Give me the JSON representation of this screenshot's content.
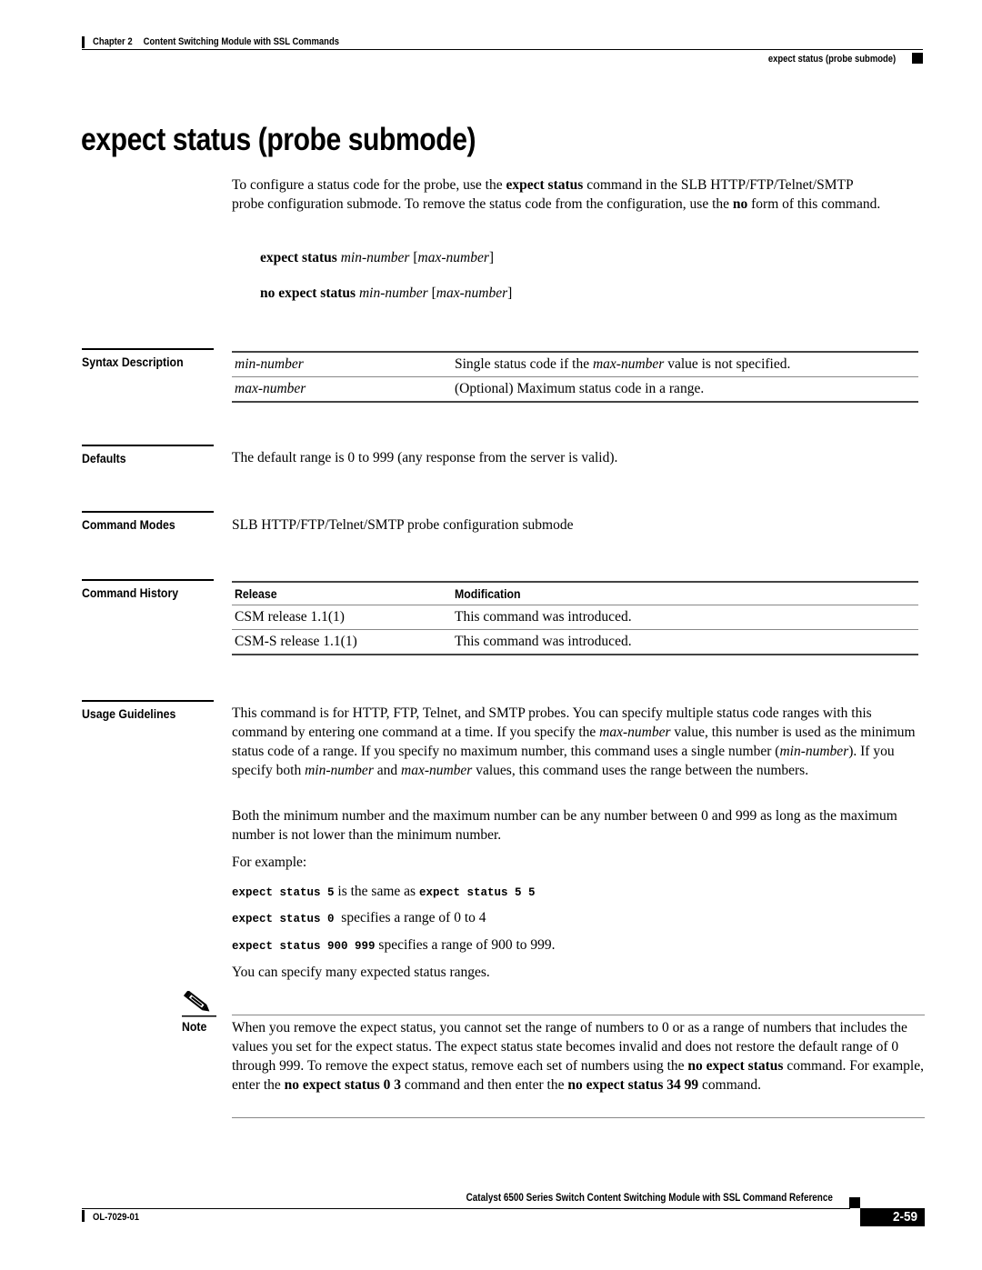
{
  "header": {
    "chapter_label": "Chapter 2",
    "chapter_title": "Content Switching Module with SSL Commands",
    "running_title": "expect status (probe submode)"
  },
  "page_title": "expect status (probe submode)",
  "intro": {
    "p1_a": "To configure a status code for the probe, use the ",
    "p1_b": "expect status",
    "p1_c": " command in the SLB HTTP/FTP/Telnet/SMTP probe configuration submode. To remove the status code from the configuration, use the ",
    "p1_d": "no",
    "p1_e": " form of this command."
  },
  "syntax": {
    "cmd1_kw": "expect status",
    "cmd1_arg": "min-number",
    "cmd1_opt": "max-number",
    "cmd2_kw": "no expect status",
    "cmd2_arg": "min-number",
    "cmd2_opt": "max-number"
  },
  "syntax_description": {
    "label": "Syntax Description",
    "rows": [
      {
        "param": "min-number",
        "desc_a": "Single status code if the ",
        "desc_it": "max-number",
        "desc_b": " value is not specified."
      },
      {
        "param": "max-number",
        "desc_a": "(Optional) Maximum status code in a range.",
        "desc_it": "",
        "desc_b": ""
      }
    ]
  },
  "defaults": {
    "label": "Defaults",
    "text": "The default range is 0 to 999 (any response from the server is valid)."
  },
  "command_modes": {
    "label": "Command Modes",
    "text": "SLB HTTP/FTP/Telnet/SMTP probe configuration submode"
  },
  "command_history": {
    "label": "Command History",
    "headers": [
      "Release",
      "Modification"
    ],
    "rows": [
      {
        "release": "CSM release 1.1(1)",
        "modification": "This command was introduced."
      },
      {
        "release": "CSM-S release 1.1(1)",
        "modification": "This command was introduced."
      }
    ]
  },
  "usage_guidelines": {
    "label": "Usage Guidelines",
    "p1_a": "This command is for HTTP, FTP, Telnet, and SMTP probes. You can specify multiple status code ranges with this command by entering one command at a time. If you specify the ",
    "p1_it1": "max-number",
    "p1_b": " value, this number is used as the minimum status code of a range. If you specify no maximum number, this command uses a single number (",
    "p1_it2": "min-number",
    "p1_c": "). If you specify both ",
    "p1_it3": "min-number",
    "p1_d": " and ",
    "p1_it4": "max-number",
    "p1_e": " values, this command uses the range between the numbers.",
    "p2": "Both the minimum number and the maximum number can be any number between 0 and 999 as long as the maximum number is not lower than the minimum number.",
    "p3": "For example:",
    "examples": [
      {
        "code1": "expect status 5",
        "text": " is the same as ",
        "code2": "expect status 5 5"
      },
      {
        "code1": "expect status 0",
        "text": "  specifies a range of 0 to 4",
        "code2": ""
      },
      {
        "code1": "expect status 900 999",
        "text": " specifies a range of 900 to 999.",
        "code2": ""
      }
    ],
    "p4": "You can specify many expected status ranges."
  },
  "note": {
    "label": "Note",
    "icon": "pencil-note-icon",
    "t1": "When you remove the expect status, you cannot set the range of numbers to 0 or as a range of numbers that includes the values you set for the expect status. The expect status state becomes invalid and does not restore the default range of 0 through 999. To remove the expect status, remove each set of numbers using the ",
    "b1": "no expect status",
    "t2": " command. For example, enter the ",
    "b2": "no expect status 0 3",
    "t3": " command and then enter the ",
    "b3": "no expect status 34 99",
    "t4": " command."
  },
  "footer": {
    "book_title": "Catalyst 6500 Series Switch Content Switching Module with SSL Command Reference",
    "doc_number": "OL-7029-01",
    "page_number": "2-59"
  }
}
